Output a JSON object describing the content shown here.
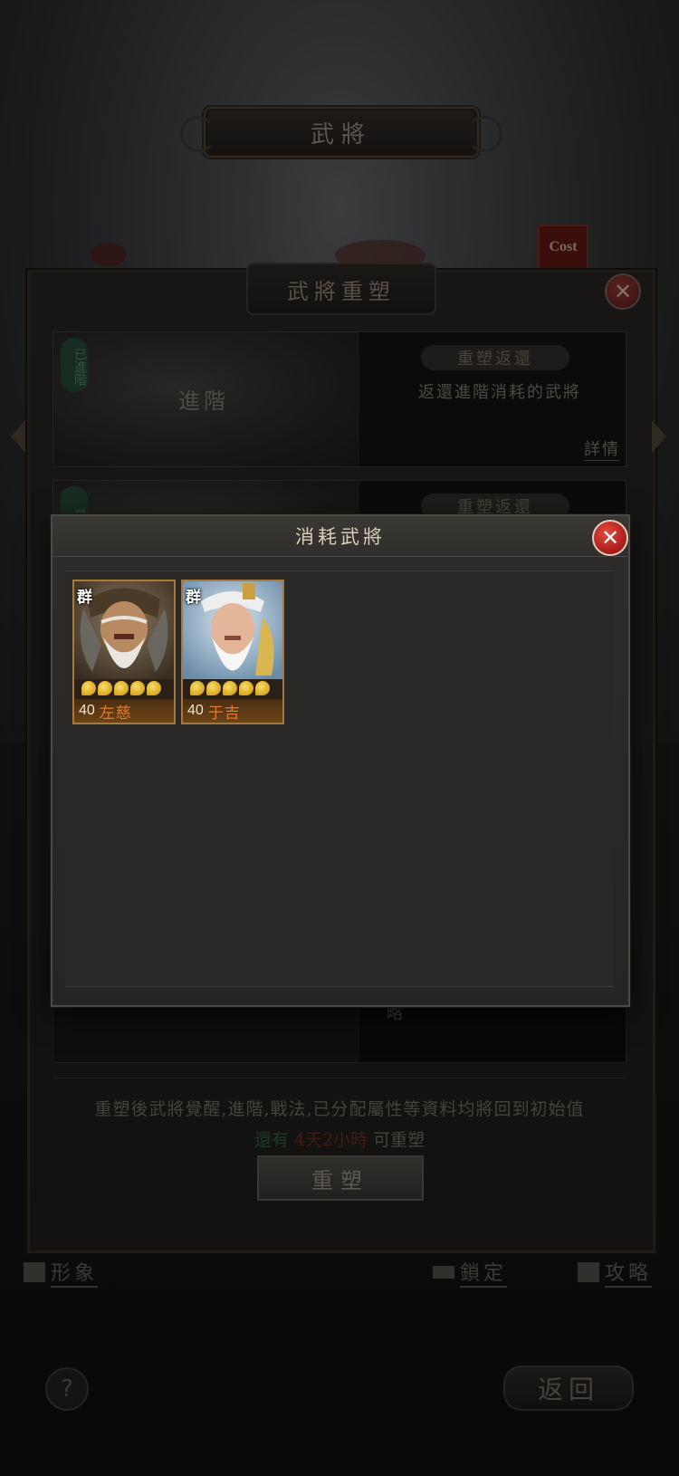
{
  "screen": {
    "top_title": "武將",
    "cost_badge": "Cost"
  },
  "rebuild_panel": {
    "title": "武將重塑",
    "close_glyph": "✕",
    "cards": [
      {
        "art_label": "進階",
        "stamp": "已進階",
        "action_label": "重塑返還",
        "description": "返還進階消耗的武將",
        "detail_link": "詳情"
      },
      {
        "stamp": "已",
        "action_label": "重塑返還"
      },
      {
        "fragment": "略"
      }
    ],
    "notice": "重塑後武將覺醒,進階,戰法,已分配屬性等資料均將回到初始值",
    "remain_prefix": "還有",
    "remain_time": "4天2小時",
    "remain_suffix": "可重塑",
    "rebuild_button": "重塑"
  },
  "bottom_bar": {
    "appearance": "形象",
    "lock": "鎖定",
    "strategy": "攻略",
    "help": "?",
    "back": "返回"
  },
  "modal": {
    "title": "消耗武將",
    "close_glyph": "✕",
    "generals": [
      {
        "faction": "群",
        "level": "40",
        "name": "左慈",
        "stars": 5,
        "star_color": "#e8b531",
        "name_color": "#e8792e"
      },
      {
        "faction": "群",
        "level": "40",
        "name": "于吉",
        "stars": 5,
        "star_color": "#e8b531",
        "name_color": "#e8792e"
      }
    ]
  },
  "colors": {
    "accent_red": "#c3261e",
    "card_border_gold": "#a57a3c",
    "text_light": "#d9cfb9"
  }
}
